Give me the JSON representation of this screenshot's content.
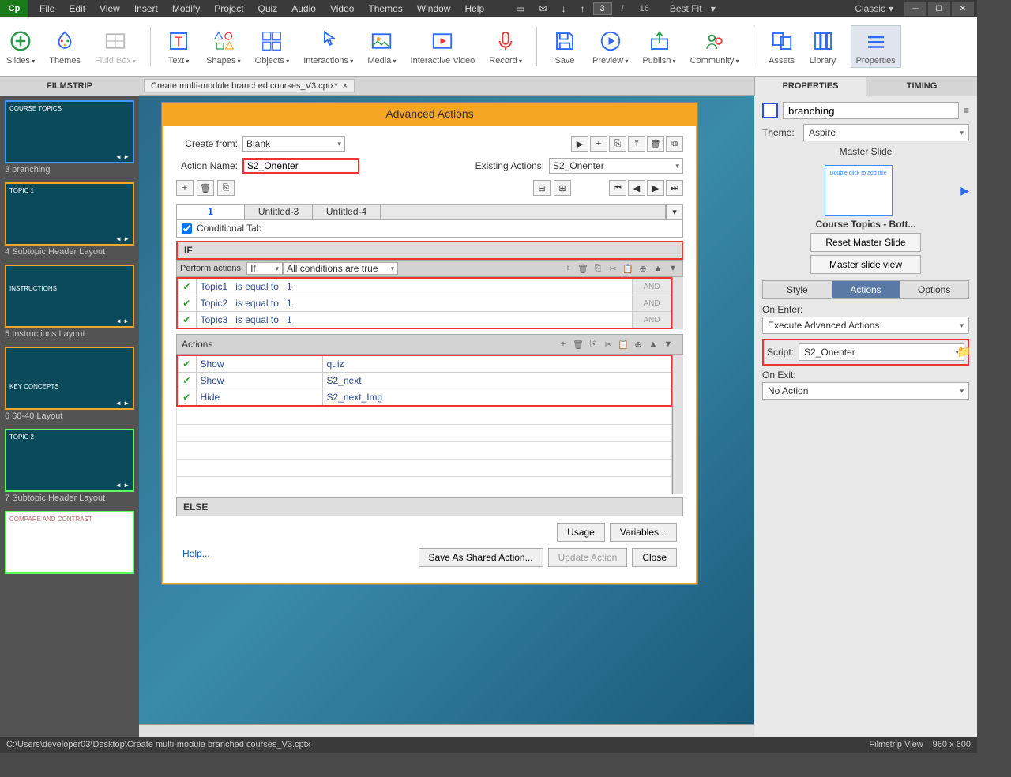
{
  "logo": "Cp",
  "menu": [
    "File",
    "Edit",
    "View",
    "Insert",
    "Modify",
    "Project",
    "Quiz",
    "Audio",
    "Video",
    "Themes",
    "Window",
    "Help"
  ],
  "pager": {
    "current": "3",
    "total": "16",
    "zoom": "Best Fit"
  },
  "workspace": "Classic",
  "ribbon": [
    {
      "label": "Slides",
      "dd": true
    },
    {
      "label": "Themes"
    },
    {
      "label": "Fluid Box",
      "dd": true,
      "disabled": true
    },
    {
      "sep": true
    },
    {
      "label": "Text",
      "dd": true
    },
    {
      "label": "Shapes",
      "dd": true
    },
    {
      "label": "Objects",
      "dd": true
    },
    {
      "label": "Interactions",
      "dd": true
    },
    {
      "label": "Media",
      "dd": true
    },
    {
      "label": "Interactive Video"
    },
    {
      "label": "Record",
      "dd": true
    },
    {
      "sep": true
    },
    {
      "label": "Save"
    },
    {
      "label": "Preview",
      "dd": true
    },
    {
      "label": "Publish",
      "dd": true
    },
    {
      "label": "Community",
      "dd": true
    },
    {
      "sep": true
    },
    {
      "label": "Assets"
    },
    {
      "label": "Library"
    },
    {
      "label": "Properties"
    }
  ],
  "filmstrip_header": "FILMSTRIP",
  "filmstrip": [
    {
      "label": "3 branching",
      "title": "COURSE TOPICS",
      "sel": true
    },
    {
      "label": "4 Subtopic Header Layout",
      "title": "TOPIC 1"
    },
    {
      "label": "5 Instructions Layout",
      "title": "INSTRUCTIONS"
    },
    {
      "label": "6 60-40 Layout",
      "title": "KEY CONCEPTS"
    },
    {
      "label": "7 Subtopic Header Layout",
      "title": "TOPIC 2",
      "green": true
    },
    {
      "label": "",
      "title": "COMPARE AND CONTRAST",
      "green": true
    }
  ],
  "doc_tab": "Create multi-module branched courses_V3.cptx*",
  "aa": {
    "title": "Advanced Actions",
    "create_from_label": "Create from:",
    "create_from_value": "Blank",
    "action_name_label": "Action Name:",
    "action_name_value": "S2_Onenter",
    "existing_label": "Existing Actions:",
    "existing_value": "S2_Onenter",
    "tabs": [
      "1",
      "Untitled-3",
      "Untitled-4"
    ],
    "conditional_label": "Conditional Tab",
    "if_label": "IF",
    "perform_label": "Perform actions:",
    "perform_type": "If",
    "cond_match": "All conditions are true",
    "conditions": [
      {
        "var": "Topic1",
        "op": "is equal to",
        "val": "1",
        "andor": "AND"
      },
      {
        "var": "Topic2",
        "op": "is equal to",
        "val": "1",
        "andor": "AND"
      },
      {
        "var": "Topic3",
        "op": "is equal to",
        "val": "1",
        "andor": "AND"
      }
    ],
    "actions_label": "Actions",
    "actions": [
      {
        "cmd": "Show",
        "target": "quiz"
      },
      {
        "cmd": "Show",
        "target": "S2_next"
      },
      {
        "cmd": "Hide",
        "target": "S2_next_Img"
      }
    ],
    "else_label": "ELSE",
    "usage_btn": "Usage",
    "variables_btn": "Variables...",
    "help_link": "Help...",
    "save_shared_btn": "Save As Shared Action...",
    "update_btn": "Update Action",
    "close_btn": "Close"
  },
  "props": {
    "tab_properties": "PROPERTIES",
    "tab_timing": "TIMING",
    "name_value": "branching",
    "theme_label": "Theme:",
    "theme_value": "Aspire",
    "master_label": "Master Slide",
    "master_preview_text": "Double click to add title",
    "master_name": "Course Topics - Bott...",
    "reset_btn": "Reset Master Slide",
    "master_view_btn": "Master slide view",
    "sub_tabs": [
      "Style",
      "Actions",
      "Options"
    ],
    "on_enter_label": "On Enter:",
    "on_enter_value": "Execute Advanced Actions",
    "script_label": "Script:",
    "script_value": "S2_Onenter",
    "on_exit_label": "On Exit:",
    "on_exit_value": "No Action"
  },
  "status": {
    "path": "C:\\Users\\developer03\\Desktop\\Create multi-module branched courses_V3.cptx",
    "view": "Filmstrip View",
    "dims": "960 x 600"
  }
}
